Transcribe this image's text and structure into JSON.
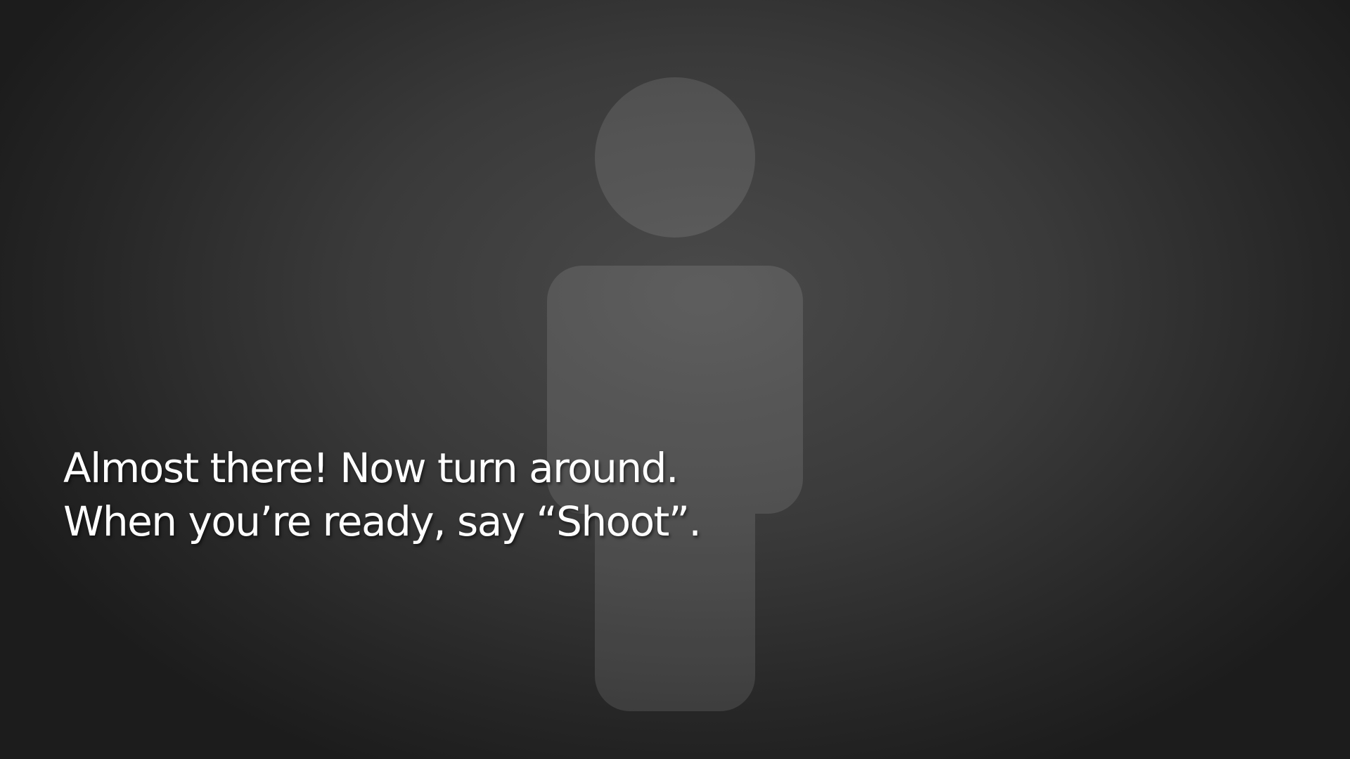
{
  "silhouette": {
    "icon": "person-silhouette-icon"
  },
  "prompt": {
    "line1": "Almost there! Now turn around.",
    "line2": "When you’re ready, say “Shoot”."
  },
  "colors": {
    "text": "#ffffff",
    "background": "#3a3a3a"
  }
}
